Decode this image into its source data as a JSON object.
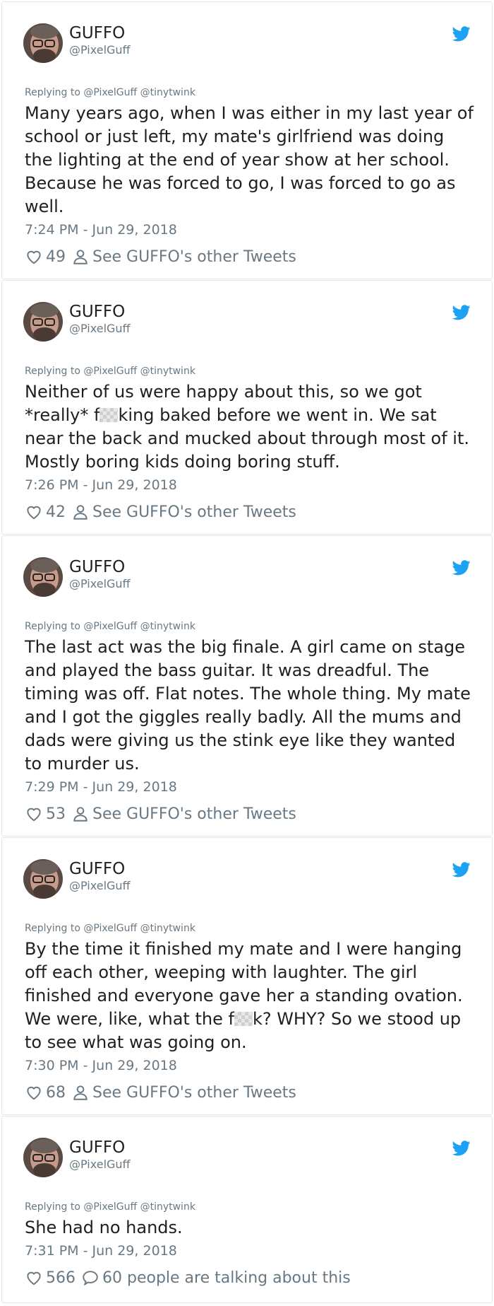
{
  "author": {
    "name": "GUFFO",
    "handle": "@PixelGuff"
  },
  "colors": {
    "twitter_blue": "#1da1f2",
    "muted_text": "#697882",
    "body_text": "#1c2022",
    "border": "#e1e8ed"
  },
  "icons": {
    "brand": "twitter-bird-icon",
    "like": "heart-icon",
    "profile": "person-icon",
    "conversation": "speech-bubble-icon"
  },
  "tweets": [
    {
      "replying_to": "Replying to @PixelGuff @tinytwink",
      "text": "Many years ago, when I was either in my last year of school or just left, my mate's girlfriend was doing the lighting at the end of year show at her school. Because he was forced to go, I was forced to go as well.",
      "timestamp": "7:24 PM - Jun 29, 2018",
      "likes": "49",
      "link_text": "See GUFFO's other Tweets"
    },
    {
      "replying_to": "Replying to @PixelGuff @tinytwink",
      "text_before": "Neither of us were happy about this, so we got *really* f",
      "text_after": "king baked before we went in. We sat near the back and mucked about through most of it. Mostly boring kids doing boring stuff.",
      "timestamp": "7:26 PM - Jun 29, 2018",
      "likes": "42",
      "link_text": "See GUFFO's other Tweets"
    },
    {
      "replying_to": "Replying to @PixelGuff @tinytwink",
      "text": "The last act was the big finale. A girl came on stage and played the bass guitar. It was dreadful. The timing was off. Flat notes. The whole thing. My mate and I got the giggles really badly. All the mums and dads were giving us the stink eye like they wanted to murder us.",
      "timestamp": "7:29 PM - Jun 29, 2018",
      "likes": "53",
      "link_text": "See GUFFO's other Tweets"
    },
    {
      "replying_to": "Replying to @PixelGuff @tinytwink",
      "text_before": "By the time it finished my mate and I were hanging off each other, weeping with laughter. The girl finished and everyone gave her a standing ovation. We were, like, what the f",
      "text_after": "k? WHY? So we stood up to see what was going on.",
      "timestamp": "7:30 PM - Jun 29, 2018",
      "likes": "68",
      "link_text": "See GUFFO's other Tweets"
    },
    {
      "replying_to": "Replying to @PixelGuff @tinytwink",
      "text": "She had no hands.",
      "timestamp": "7:31 PM - Jun 29, 2018",
      "likes": "566",
      "link_text": "60 people are talking about this"
    }
  ]
}
